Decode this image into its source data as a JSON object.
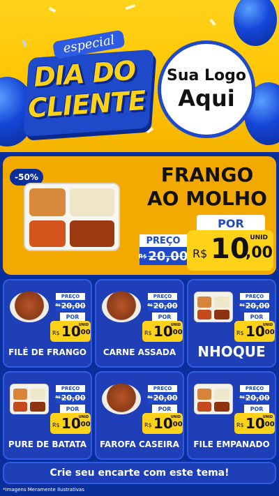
{
  "header": {
    "badge_top": "especial",
    "badge_line1": "DIA DO",
    "badge_line2": "CLIENTE",
    "logo_line1": "Sua Logo",
    "logo_line2": "Aqui"
  },
  "featured": {
    "discount": "-50%",
    "name_line1": "FRANGO",
    "name_line2": "AO MOLHO",
    "preco_label": "PREÇO",
    "old_currency": "R$",
    "old_price": "20,00",
    "por_label": "POR",
    "unid_label": "UNID",
    "new_currency": "R$",
    "new_int": "10",
    "new_dec": ",00"
  },
  "products": [
    {
      "name": "FILÉ DE FRANGO",
      "preco_label": "PREÇO",
      "old_currency": "R$",
      "old_price": "20,00",
      "por_label": "POR",
      "unid_label": "UNID",
      "new_currency": "R$",
      "new_int": "10",
      "new_dec": ",00"
    },
    {
      "name": "CARNE ASSADA",
      "preco_label": "PREÇO",
      "old_currency": "R$",
      "old_price": "20,00",
      "por_label": "POR",
      "unid_label": "UNID",
      "new_currency": "R$",
      "new_int": "10",
      "new_dec": ",00"
    },
    {
      "name": "NHOQUE",
      "preco_label": "PREÇO",
      "old_currency": "R$",
      "old_price": "20,00",
      "por_label": "POR",
      "unid_label": "UNID",
      "new_currency": "R$",
      "new_int": "10",
      "new_dec": ",00"
    },
    {
      "name": "PURE DE BATATA",
      "preco_label": "PREÇO",
      "old_currency": "R$",
      "old_price": "20,00",
      "por_label": "POR",
      "unid_label": "UNID",
      "new_currency": "R$",
      "new_int": "10",
      "new_dec": ",00"
    },
    {
      "name": "FAROFA CASEIRA",
      "preco_label": "PREÇO",
      "old_currency": "R$",
      "old_price": "20,00",
      "por_label": "POR",
      "unid_label": "UNID",
      "new_currency": "R$",
      "new_int": "10",
      "new_dec": ",00"
    },
    {
      "name": "FILE EMPANADO",
      "preco_label": "PREÇO",
      "old_currency": "R$",
      "old_price": "20,00",
      "por_label": "POR",
      "unid_label": "UNID",
      "new_currency": "R$",
      "new_int": "10",
      "new_dec": ",00"
    }
  ],
  "footer": {
    "cta": "Crie seu encarte com este tema!",
    "disclaimer": "*Imagens Meramente Ilustrativas"
  },
  "colors": {
    "primary_blue": "#1e49c9",
    "yellow": "#ffd21a",
    "orange": "#f2a900"
  }
}
